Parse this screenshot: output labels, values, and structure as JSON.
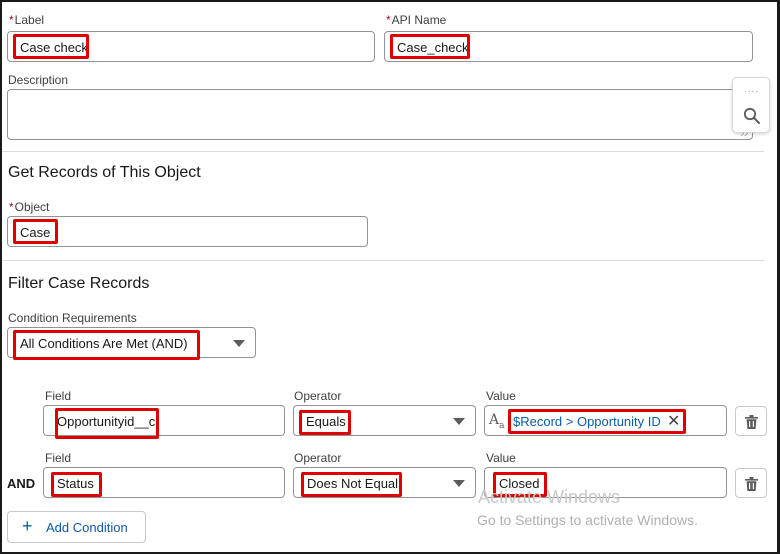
{
  "label_field": {
    "label": "Label",
    "value": "Case check"
  },
  "api_name_field": {
    "label": "API Name",
    "value": "Case_check"
  },
  "description_field": {
    "label": "Description",
    "value": ""
  },
  "get_records_section": {
    "title": "Get Records of This Object",
    "object_label": "Object",
    "object_value": "Case"
  },
  "filter_section": {
    "title": "Filter Case Records",
    "condition_requirements_label": "Condition Requirements",
    "condition_requirements_value": "All Conditions Are Met (AND)",
    "conditions": [
      {
        "field_label": "Field",
        "field_value": "Opportunityid__c",
        "operator_label": "Operator",
        "operator_value": "Equals",
        "value_label": "Value",
        "value_value": "$Record > Opportunity ID"
      },
      {
        "connector": "AND",
        "field_label": "Field",
        "field_value": "Status",
        "operator_label": "Operator",
        "operator_value": "Does Not Equal",
        "value_label": "Value",
        "value_value": "Closed"
      }
    ],
    "add_condition_label": "Add Condition"
  },
  "side_panel": {
    "dots": "....",
    "icons": [
      "search-icon"
    ]
  },
  "watermark": {
    "line1": "Activate Windows",
    "line2": "Go to Settings to activate Windows."
  },
  "colors": {
    "highlight": "#e00000",
    "link": "#0b5cab",
    "required": "#ba0517"
  }
}
